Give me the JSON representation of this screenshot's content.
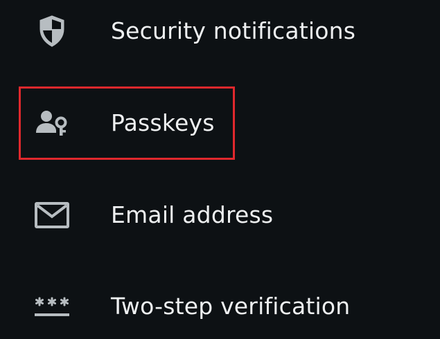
{
  "menu": {
    "items": [
      {
        "label": "Security notifications",
        "icon": "shield-icon"
      },
      {
        "label": "Passkeys",
        "icon": "user-key-icon",
        "highlighted": true
      },
      {
        "label": "Email address",
        "icon": "mail-icon"
      },
      {
        "label": "Two-step verification",
        "icon": "password-asterisks-icon"
      }
    ]
  },
  "colors": {
    "background": "#0d1114",
    "text": "#eef0f1",
    "icon": "#b7bdc1",
    "highlight": "#e0282d"
  }
}
